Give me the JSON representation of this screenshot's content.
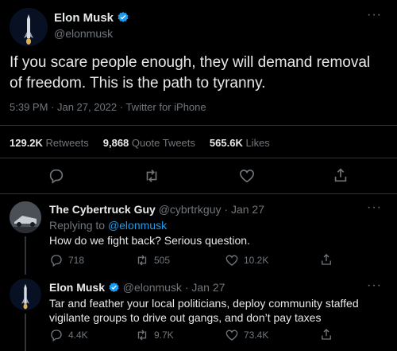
{
  "main_tweet": {
    "author_name": "Elon Musk",
    "author_handle": "@elonmusk",
    "text": "If you scare people enough, they will demand removal of freedom. This is the path to tyranny.",
    "meta": "5:39 PM · Jan 27, 2022 · Twitter for iPhone",
    "stats": {
      "retweets_value": "129.2K",
      "retweets_label": "Retweets",
      "quotes_value": "9,868",
      "quotes_label": "Quote Tweets",
      "likes_value": "565.6K",
      "likes_label": "Likes"
    },
    "more_label": "···"
  },
  "reply1": {
    "author_name": "The Cybertruck Guy",
    "author_handle": "@cybrtrkguy",
    "date": "· Jan 27",
    "replying_prefix": "Replying to",
    "replying_handle": "@elonmusk",
    "text": "How do we fight back? Serious question.",
    "replies": "718",
    "retweets": "505",
    "likes": "10.2K",
    "more_label": "···"
  },
  "reply2": {
    "author_name": "Elon Musk",
    "author_handle": "@elonmusk",
    "date": "· Jan 27",
    "text": "Tar and feather your local politicians, deploy community staffed vigilante groups to drive out gangs, and don’t pay taxes",
    "replies": "4.4K",
    "retweets": "9.7K",
    "likes": "73.4K",
    "more_label": "···"
  },
  "colors": {
    "background": "#000000",
    "text": "#e7e9ea",
    "muted": "#71767b",
    "link": "#1d9bf0",
    "divider": "#2f3336",
    "verified": "#1d9bf0"
  }
}
